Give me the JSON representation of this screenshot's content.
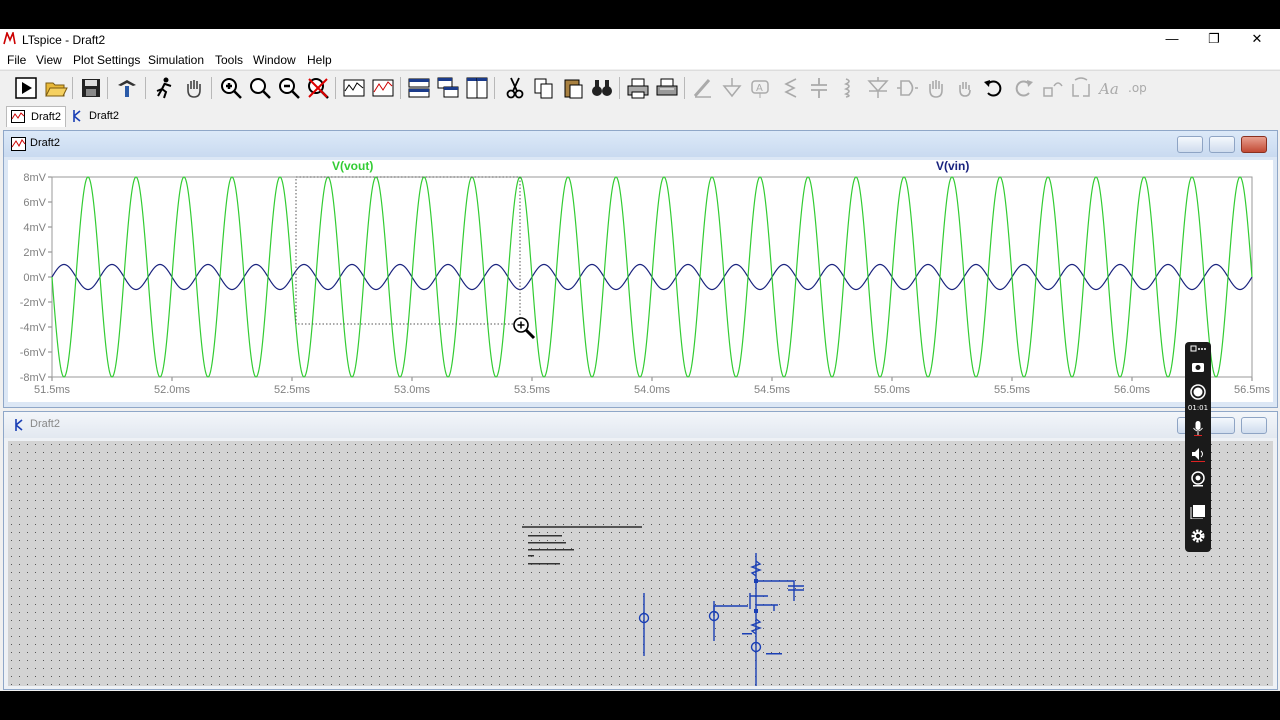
{
  "window": {
    "title": "LTspice - Draft2",
    "minimize_glyph": "—",
    "maximize_glyph": "❐",
    "close_glyph": "✕"
  },
  "menu": [
    "File",
    "View",
    "Plot Settings",
    "Simulation",
    "Tools",
    "Window",
    "Help"
  ],
  "toolbar_icons": [
    "run-icon",
    "open-icon",
    "save-icon",
    "control-panel-icon",
    "autorange-icon",
    "pan-icon",
    "zoom-in-icon",
    "zoom-box-icon",
    "zoom-out-icon",
    "zoom-cancel-icon",
    "plot-settings-icon",
    "waveform-icon",
    "tile-horizontal-icon",
    "cascade-icon",
    "tile-vertical-icon",
    "cut-icon",
    "copy-icon",
    "paste-icon",
    "find-icon",
    "print-icon",
    "print-setup-icon",
    "wire-icon",
    "ground-icon",
    "label-icon",
    "resistor-icon",
    "capacitor-icon",
    "inductor-icon",
    "diode-icon",
    "component-icon",
    "move-icon",
    "drag-icon",
    "undo-icon",
    "redo-icon",
    "rotate-icon",
    "mirror-icon",
    "text-icon",
    "spice-directive-icon"
  ],
  "tabs": [
    {
      "label": "Draft2",
      "icon": "waveform-icon",
      "active": true
    },
    {
      "label": "Draft2",
      "icon": "schematic-icon",
      "active": false
    }
  ],
  "plot_window": {
    "title": "Draft2",
    "trace_vout_label": "V(vout)",
    "trace_vin_label": "V(vin)",
    "colors": {
      "vout": "#33cc33",
      "vin": "#1a237e",
      "frame": "#9a9a9a",
      "background": "#ffffff"
    }
  },
  "schematic_window": {
    "title": "Draft2",
    "background": "#d3d3d3",
    "wire_color": "#1a3fb5"
  },
  "recorder": {
    "time": "01:01"
  },
  "chart_data": {
    "type": "line",
    "xlabel": "",
    "ylabel": "",
    "xlim": [
      51.5,
      56.5
    ],
    "ylim": [
      -8,
      8
    ],
    "x_ticks": [
      "51.5ms",
      "52.0ms",
      "52.5ms",
      "53.0ms",
      "53.5ms",
      "54.0ms",
      "54.5ms",
      "55.0ms",
      "55.5ms",
      "56.0ms",
      "56.5ms"
    ],
    "y_ticks": [
      "8mV",
      "6mV",
      "4mV",
      "2mV",
      "0mV",
      "-2mV",
      "-4mV",
      "-6mV",
      "-8mV"
    ],
    "grid": false,
    "series": [
      {
        "name": "V(vout)",
        "kind": "sine",
        "amplitude_mV": 8,
        "period_ms": 0.2,
        "phase_deg": 180
      },
      {
        "name": "V(vin)",
        "kind": "sine",
        "amplitude_mV": 1,
        "period_ms": 0.2,
        "phase_deg": 0
      }
    ]
  }
}
